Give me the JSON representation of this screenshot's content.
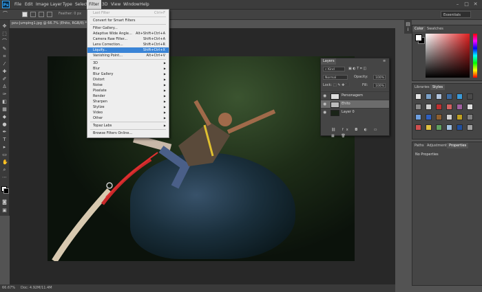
{
  "app": {
    "logo": "Ps"
  },
  "menubar": {
    "items": [
      "File",
      "Edit",
      "Image",
      "Layer",
      "Type",
      "Select",
      "Filter",
      "3D",
      "View",
      "Window",
      "Help"
    ],
    "window_controls": [
      "–",
      "□",
      "✕"
    ]
  },
  "options": {
    "feather": "Feather: 0 px",
    "workspace": "Essentials"
  },
  "document": {
    "tab_title": "pzu-Jumping1.jpg @ 66.7% (Ehito, RGB/8) *"
  },
  "status": {
    "zoom": "66.67%",
    "doc": "Doc: 4.92M/11.4M"
  },
  "filter_menu": {
    "items": [
      {
        "label": "Last Filter",
        "shortcut": "Ctrl+F",
        "disabled": true
      },
      {
        "label": "Convert for Smart Filters",
        "shortcut": ""
      },
      {
        "label": "Filter Gallery...",
        "shortcut": ""
      },
      {
        "label": "Adaptive Wide Angle...",
        "shortcut": "Alt+Shift+Ctrl+A"
      },
      {
        "label": "Camera Raw Filter...",
        "shortcut": "Shift+Ctrl+A"
      },
      {
        "label": "Lens Correction...",
        "shortcut": "Shift+Ctrl+R"
      },
      {
        "label": "Liquify...",
        "shortcut": "Shift+Ctrl+X",
        "highlighted": true
      },
      {
        "label": "Vanishing Point...",
        "shortcut": "Alt+Ctrl+V"
      },
      {
        "label": "3D",
        "submenu": true
      },
      {
        "label": "Blur",
        "submenu": true
      },
      {
        "label": "Blur Gallery",
        "submenu": true
      },
      {
        "label": "Distort",
        "submenu": true
      },
      {
        "label": "Noise",
        "submenu": true
      },
      {
        "label": "Pixelate",
        "submenu": true
      },
      {
        "label": "Render",
        "submenu": true
      },
      {
        "label": "Sharpen",
        "submenu": true
      },
      {
        "label": "Stylize",
        "submenu": true
      },
      {
        "label": "Video",
        "submenu": true
      },
      {
        "label": "Other",
        "submenu": true
      },
      {
        "label": "Topaz Labs",
        "submenu": true
      },
      {
        "label": "Browse Filters Online...",
        "shortcut": ""
      }
    ]
  },
  "color_panel": {
    "tabs": [
      "Color",
      "Swatches"
    ]
  },
  "styles_panel": {
    "tabs": [
      "Libraries",
      "Styles"
    ],
    "swatches": [
      "#e4e4e4",
      "#7aa0c8",
      "#b0c4de",
      "#3b6aa0",
      "#3a9ad9",
      "#4a4a4a",
      "#8a8a8a",
      "#d0d0d0",
      "#c03030",
      "#d46060",
      "#a060a0",
      "#e0e0e0",
      "#6fa0e0",
      "#3060c0",
      "#906030",
      "#d0d0d0",
      "#c0a020",
      "#808080",
      "#d05050",
      "#e0c040",
      "#60a060",
      "#a0c0e0",
      "#2050a0",
      "#a0a0a0"
    ]
  },
  "properties_panel": {
    "tabs": [
      "Paths",
      "Adjustments",
      "Properties"
    ],
    "message": "No Properties"
  },
  "layers_panel": {
    "tab": "Layers",
    "kind": "Kind",
    "blend": "Normal",
    "opacity_label": "Opacity:",
    "opacity": "100%",
    "lock_label": "Lock:",
    "fill_label": "Fill:",
    "fill": "100%",
    "layers": [
      {
        "name": "Personagem",
        "selected": false
      },
      {
        "name": "Ehito",
        "selected": true
      },
      {
        "name": "Layer 0",
        "selected": false
      }
    ]
  }
}
